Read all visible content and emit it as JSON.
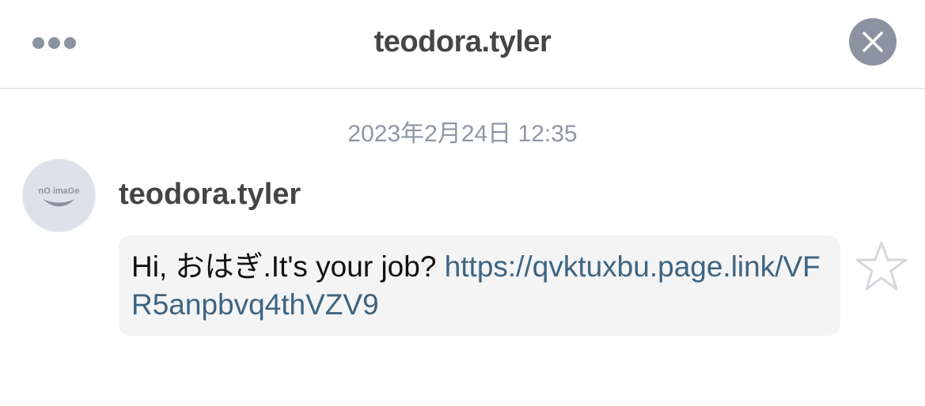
{
  "header": {
    "title": "teodora.tyler",
    "menu_icon": "ellipsis-icon",
    "close_icon": "close-icon"
  },
  "conversation": {
    "timestamp": "2023年2月24日 12:35",
    "message": {
      "sender": "teodora.tyler",
      "avatar_text": "nO imaGe",
      "text": "Hi, おはぎ.It's your job? ",
      "link": "https://qvktuxbu.page.link/VFR5anpbvq4thVZV9",
      "star_icon": "star-outline-icon"
    }
  },
  "colors": {
    "icon_gray": "#8b93a0",
    "title_text": "#454545",
    "timestamp_text": "#9097a3",
    "link": "#3d6482",
    "bubble_bg": "#f4f4f5",
    "divider": "#e6e6e6"
  }
}
